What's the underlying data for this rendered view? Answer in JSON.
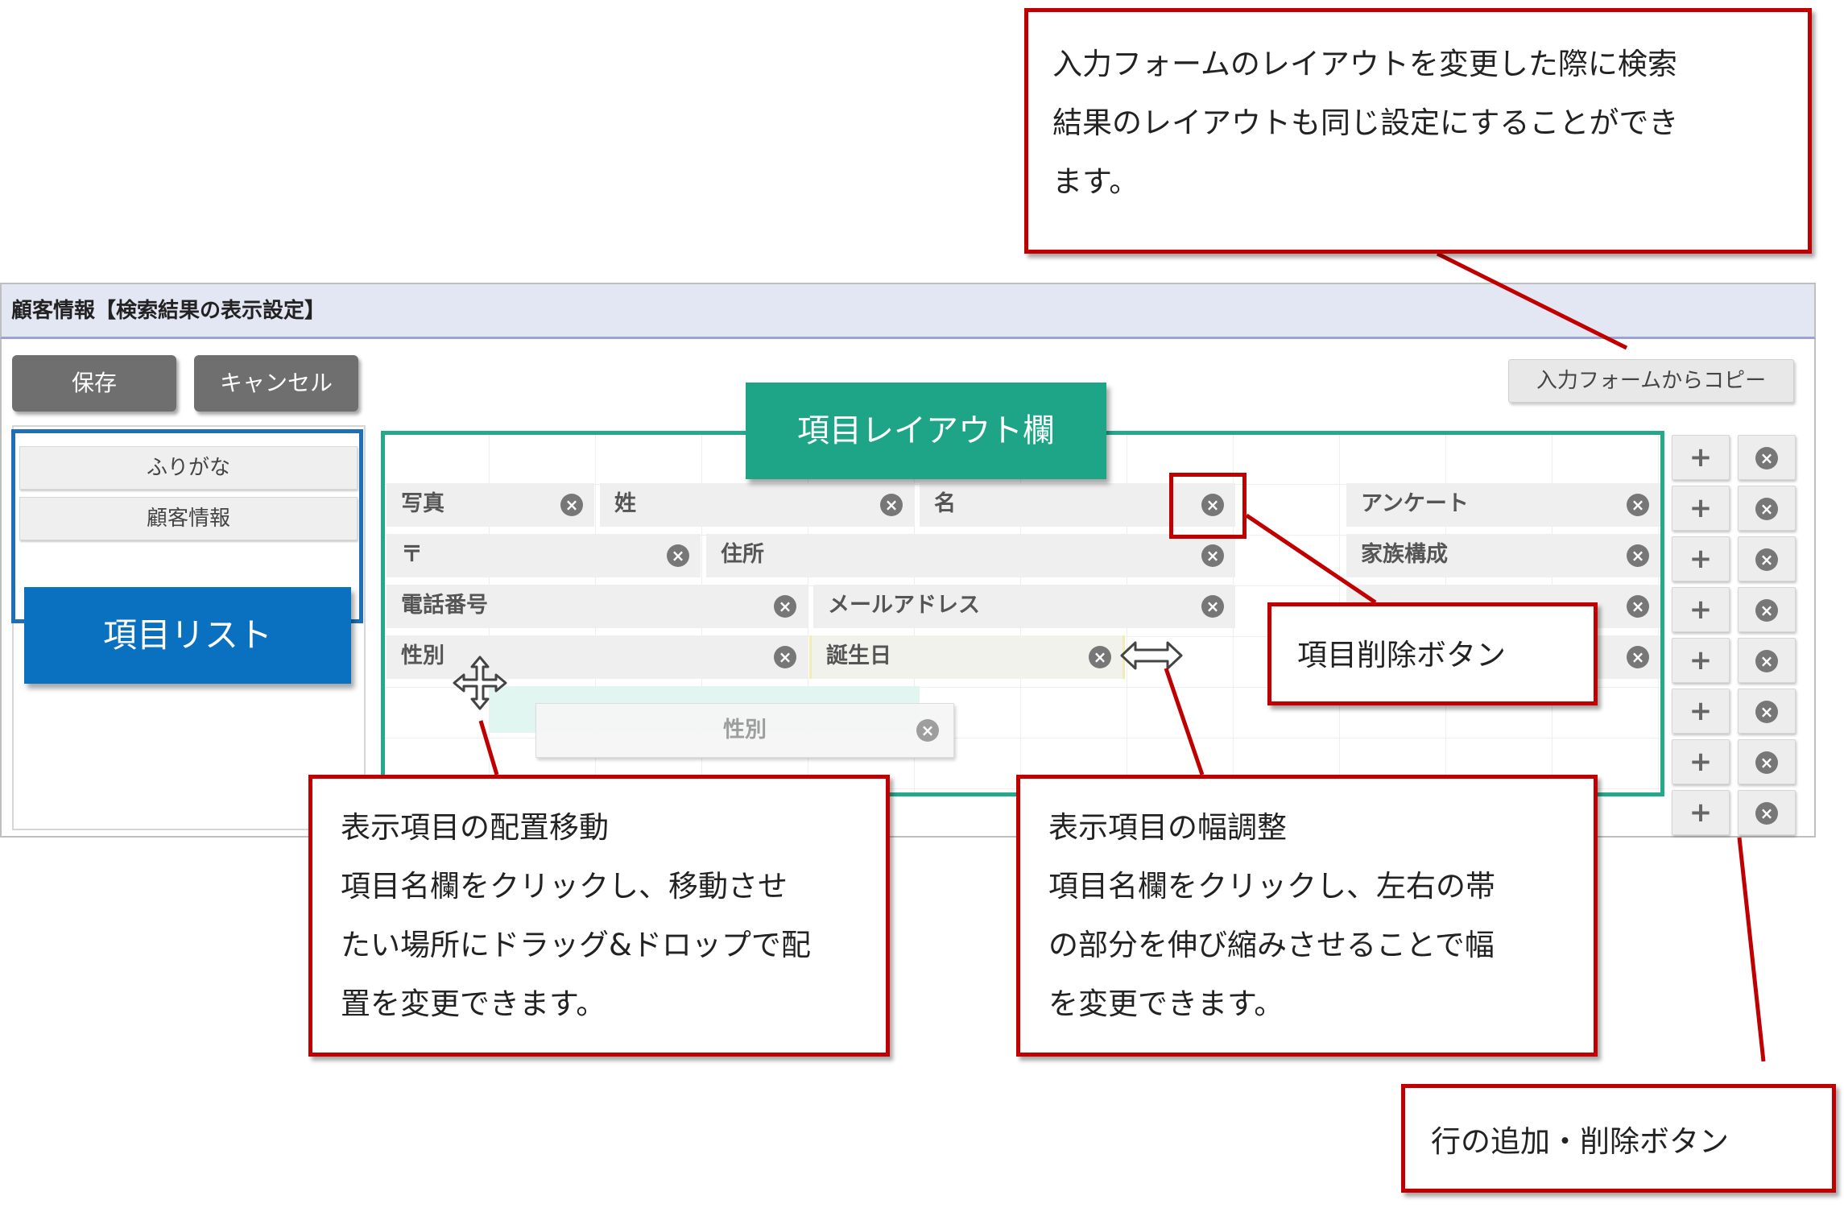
{
  "window": {
    "title": "顧客情報【検索結果の表示設定】"
  },
  "toolbar": {
    "save_label": "保存",
    "cancel_label": "キャンセル",
    "copy_label": "入力フォームからコピー"
  },
  "item_list": {
    "items": [
      {
        "label": "ふりがな"
      },
      {
        "label": "顧客情報"
      }
    ],
    "annotation_label": "項目リスト"
  },
  "layout": {
    "annotation_label": "項目レイアウト欄",
    "fields": [
      {
        "label": "写真"
      },
      {
        "label": "姓"
      },
      {
        "label": "名"
      },
      {
        "label": "アンケート"
      },
      {
        "label": "〒"
      },
      {
        "label": "住所"
      },
      {
        "label": "家族構成"
      },
      {
        "label": "電話番号"
      },
      {
        "label": "メールアドレス"
      },
      {
        "label": "性別"
      },
      {
        "label": "誕生日"
      }
    ],
    "drag_ghost_label": "性別",
    "row_buttons": {
      "add_glyph": "+",
      "delete_glyph": "⊗"
    }
  },
  "icons": {
    "delete_glyph": "×",
    "move_icon": "move-cursor-icon",
    "resize_icon": "horizontal-resize-icon"
  },
  "callouts": {
    "copy": {
      "lines": [
        "入力フォームのレイアウトを変更した際に検索",
        "結果のレイアウトも同じ設定にすることができ",
        "ます。"
      ]
    },
    "delete_item": {
      "lines": [
        "項目削除ボタン"
      ]
    },
    "move": {
      "lines": [
        "表示項目の配置移動",
        "項目名欄をクリックし、移動させ",
        "たい場所にドラッグ&ドロップで配",
        "置を変更できます。"
      ]
    },
    "resize": {
      "lines": [
        "表示項目の幅調整",
        "項目名欄をクリックし、左右の帯",
        "の部分を伸び縮みさせることで幅",
        "を変更できます。"
      ]
    },
    "rows": {
      "lines": [
        "行の追加・削除ボタン"
      ]
    }
  },
  "colors": {
    "callout_border": "#c00000",
    "grid_border": "#24a98b",
    "grid_label_bg": "#1ea588",
    "list_label_bg": "#0a70c0",
    "list_border": "#1f6fb8",
    "title_bar_bg": "#e3e6f3"
  }
}
